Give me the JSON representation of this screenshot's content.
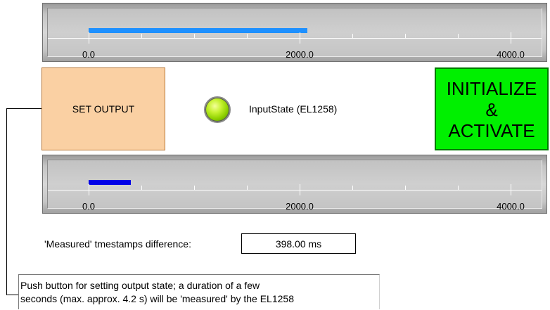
{
  "gauges": [
    {
      "name": "top",
      "fill_color": "#1e90ff",
      "value": 2075,
      "scale_min": 0,
      "scale_max": 4000,
      "labels": [
        "0.0",
        "2000.0",
        "4000.0"
      ]
    },
    {
      "name": "bottom",
      "fill_color": "#0000e6",
      "value": 398,
      "scale_min": 0,
      "scale_max": 4000,
      "labels": [
        "0.0",
        "2000.0",
        "4000.0"
      ]
    }
  ],
  "set_output": {
    "label": "SET OUTPUT",
    "color": "#fad0a3"
  },
  "input_state": {
    "label": "InputState (EL1258)",
    "led_state": "on",
    "led_color": "#a6e01a"
  },
  "init_button": {
    "line1": "INITIALIZE",
    "line2": "&",
    "line3": "ACTIVATE",
    "color": "#00f000"
  },
  "diff": {
    "label": "'Measured' tmestamps difference:",
    "value": "398.00 ms"
  },
  "comment": {
    "line1": "Push button for setting output state; a duration of a few",
    "line2": "seconds (max. approx. 4.2 s) will be 'measured' by the EL1258"
  }
}
